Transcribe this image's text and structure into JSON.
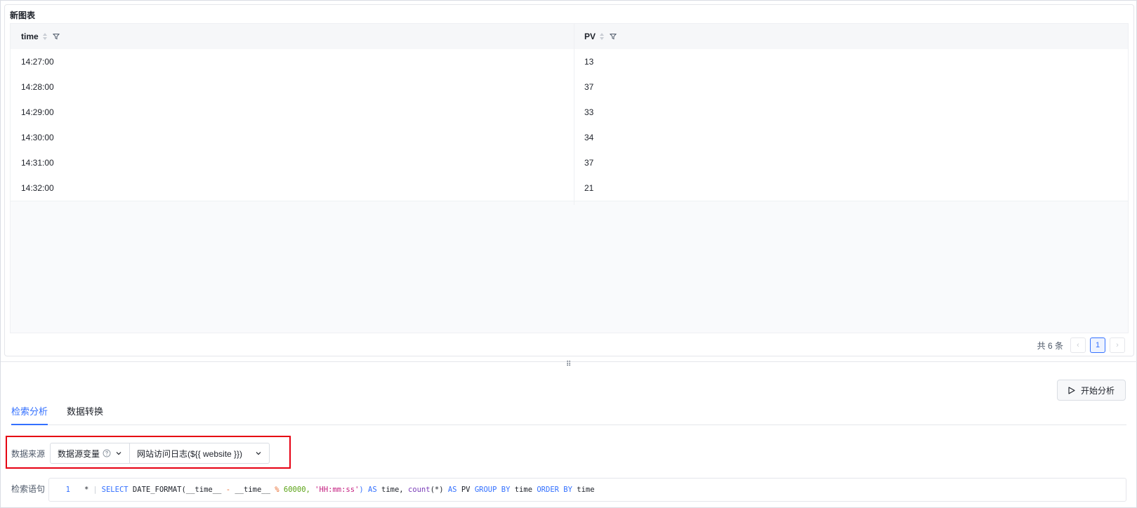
{
  "chart": {
    "title": "新图表",
    "columns": [
      "time",
      "PV"
    ],
    "rows": [
      [
        "14:27:00",
        "13"
      ],
      [
        "14:28:00",
        "37"
      ],
      [
        "14:29:00",
        "33"
      ],
      [
        "14:30:00",
        "34"
      ],
      [
        "14:31:00",
        "37"
      ],
      [
        "14:32:00",
        "21"
      ]
    ],
    "pagination": {
      "total_text": "共 6 条",
      "prev_icon": "‹",
      "current_page": "1",
      "next_icon": "›"
    }
  },
  "toolbar": {
    "start_label": "开始分析"
  },
  "tabs": [
    {
      "label": "检索分析",
      "active": true
    },
    {
      "label": "数据转换",
      "active": false
    }
  ],
  "datasource": {
    "label": "数据来源",
    "type_value": "数据源变量",
    "source_value": "网站访问日志(${{ website }})"
  },
  "query": {
    "label": "检索语句",
    "line_number": "1",
    "tokens": {
      "star": "*",
      "bar": "|",
      "select": "SELECT",
      "date_format": "DATE_FORMAT(__time__",
      "minus": "-",
      "time2": "__time__",
      "mod": "%",
      "num": "60000,",
      "fmt": "'HH:mm:ss'",
      "as1": ") AS",
      "time_alias": "time,",
      "count": "count",
      "count_arg": "(*)",
      "as2": "AS",
      "pv": "PV",
      "group_by": "GROUP BY",
      "time_g": "time",
      "order_by": "ORDER BY",
      "time_o": "time"
    }
  },
  "colors": {
    "accent": "#3370ff",
    "highlight": "#e60012"
  }
}
